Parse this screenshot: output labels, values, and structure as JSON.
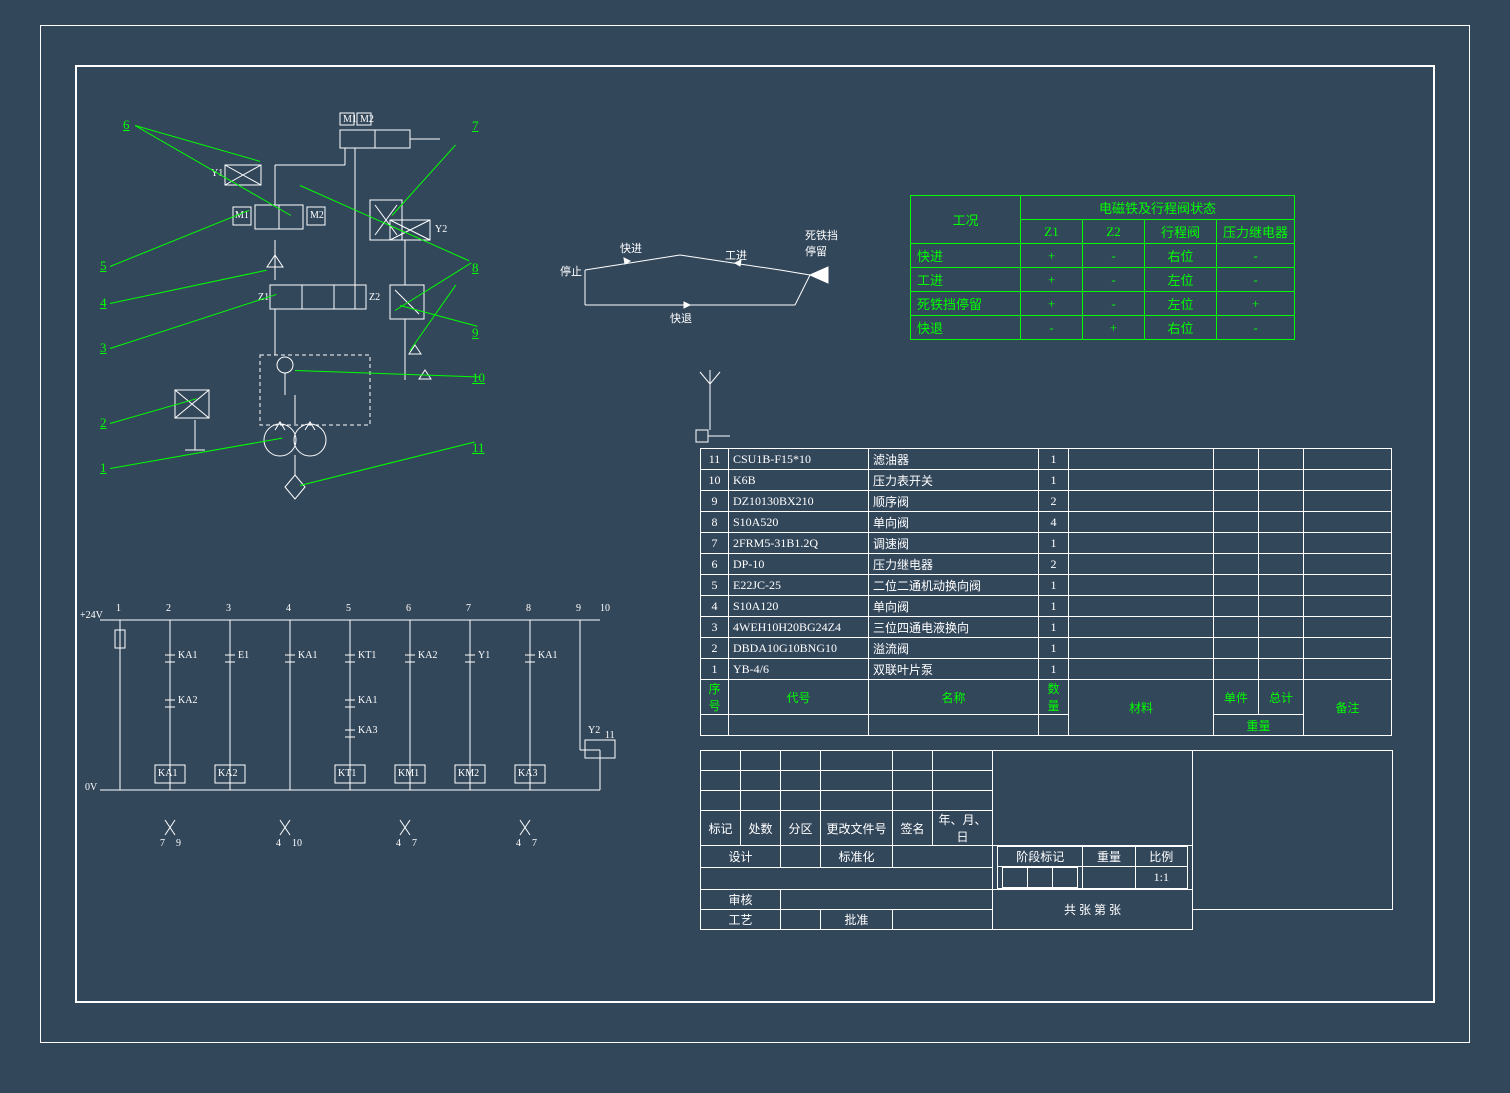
{
  "condition_table": {
    "title": "电磁铁及行程阀状态",
    "row_header": "工况",
    "cols": [
      "Z1",
      "Z2",
      "行程阀",
      "压力继电器"
    ],
    "rows": [
      {
        "name": "快进",
        "vals": [
          "+",
          "-",
          "右位",
          "-"
        ]
      },
      {
        "name": "工进",
        "vals": [
          "+",
          "-",
          "左位",
          "-"
        ]
      },
      {
        "name": "死铁挡停留",
        "vals": [
          "+",
          "-",
          "左位",
          "+"
        ]
      },
      {
        "name": "快退",
        "vals": [
          "-",
          "+",
          "右位",
          "-"
        ]
      }
    ]
  },
  "parts_list": {
    "headers": {
      "no": "序号",
      "code": "代号",
      "name": "名称",
      "qty": "数量",
      "mat": "材料",
      "uw": "单件",
      "tw": "总计",
      "wt": "重量",
      "remark": "备注"
    },
    "rows": [
      {
        "no": "11",
        "code": "CSU1B-F15*10",
        "name": "滤油器",
        "qty": "1"
      },
      {
        "no": "10",
        "code": "K6B",
        "name": "压力表开关",
        "qty": "1"
      },
      {
        "no": "9",
        "code": "DZ10130BX210",
        "name": "顺序阀",
        "qty": "2"
      },
      {
        "no": "8",
        "code": "S10A520",
        "name": "单向阀",
        "qty": "4"
      },
      {
        "no": "7",
        "code": "2FRM5-31B1.2Q",
        "name": "调速阀",
        "qty": "1"
      },
      {
        "no": "6",
        "code": "DP-10",
        "name": "压力继电器",
        "qty": "2"
      },
      {
        "no": "5",
        "code": "E22JC-25",
        "name": "二位二通机动换向阀",
        "qty": "1"
      },
      {
        "no": "4",
        "code": "S10A120",
        "name": "单向阀",
        "qty": "1"
      },
      {
        "no": "3",
        "code": "4WEH10H20BG24Z4",
        "name": "三位四通电液换向",
        "qty": "1"
      },
      {
        "no": "2",
        "code": "DBDA10G10BNG10",
        "name": "溢流阀",
        "qty": "1"
      },
      {
        "no": "1",
        "code": "YB-4/6",
        "name": "双联叶片泵",
        "qty": "1"
      }
    ]
  },
  "title_block": {
    "mark": "标记",
    "qty": "处数",
    "zone": "分区",
    "chgdoc": "更改文件号",
    "sign": "签名",
    "date": "年、月、日",
    "design": "设计",
    "std": "标准化",
    "stage": "阶段标记",
    "weight": "重量",
    "scale": "比例",
    "scale_val": "1:1",
    "review": "审核",
    "tech": "工艺",
    "approve": "批准",
    "sheet": "共    张   第    张"
  },
  "cycle": {
    "stop": "停止",
    "rapid_fwd": "快进",
    "work_fwd": "工进",
    "dead_stop": "死铁挡停留",
    "rapid_back": "快退"
  },
  "hydra_labels": {
    "M1": "M1",
    "M2": "M2",
    "Y1": "Y1",
    "Y2": "Y2",
    "Z1": "Z1",
    "Z2": "Z2",
    "Mbox1": "M1",
    "Mbox2": "M2"
  },
  "balloons": [
    "1",
    "2",
    "3",
    "4",
    "5",
    "6",
    "7",
    "8",
    "9",
    "10",
    "11"
  ],
  "ladder": {
    "top": "+24V",
    "bot": "0V",
    "cols": [
      "1",
      "2",
      "3",
      "4",
      "5",
      "6",
      "7",
      "8",
      "9",
      "10",
      "11"
    ],
    "contacts": [
      "KA1",
      "E1",
      "KA1",
      "KT1",
      "KA2",
      "KA1",
      "KA3",
      "Y1",
      "KA1",
      "KA2",
      "Y2"
    ],
    "coils": [
      "KA1",
      "KA2",
      "KT1",
      "KM1",
      "KM2",
      "KA3"
    ],
    "footnotes": [
      "7",
      "9",
      "4",
      "10",
      "4",
      "7",
      "4",
      "7"
    ]
  }
}
